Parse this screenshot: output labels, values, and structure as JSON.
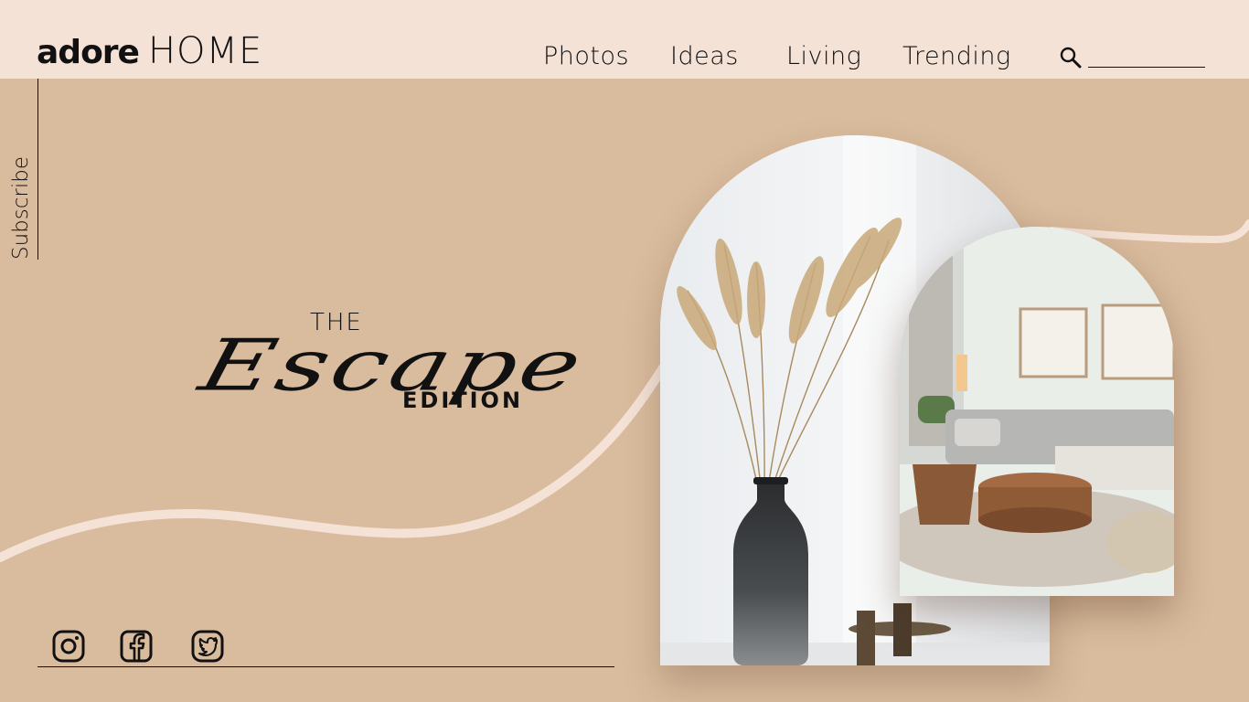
{
  "brand": {
    "bold": "adore",
    "light": "HOME"
  },
  "nav": [
    {
      "label": "Photos"
    },
    {
      "label": "Ideas"
    },
    {
      "label": "Living"
    },
    {
      "label": "Trending"
    }
  ],
  "search": {
    "value": "",
    "icon": "magnifier-icon"
  },
  "subscribe": {
    "label": "Subscribe"
  },
  "headline": {
    "the": "THE",
    "escape": "Escape",
    "edition": "EDITION"
  },
  "images": {
    "vase": "pampas-grass-vase-photo",
    "room": "living-room-photo"
  },
  "social": [
    {
      "name": "instagram-icon"
    },
    {
      "name": "facebook-icon"
    },
    {
      "name": "twitter-icon"
    }
  ],
  "colors": {
    "background": "#d9bb9d",
    "header": "#f4e2d7",
    "curve": "#f4e2d7",
    "text": "#111111"
  }
}
